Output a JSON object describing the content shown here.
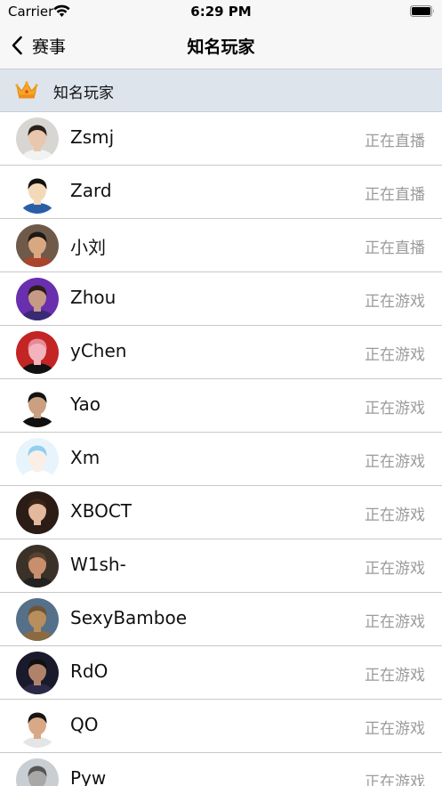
{
  "status_bar": {
    "carrier": "Carrier",
    "time": "6:29 PM"
  },
  "nav": {
    "back_label": "赛事",
    "title": "知名玩家"
  },
  "section": {
    "label": "知名玩家",
    "icon": "crown-icon"
  },
  "players": [
    {
      "name": "Zsmj",
      "status": "正在直播",
      "avatar": "photo-man-light",
      "bg": "#d8d6d2",
      "skin": "#e9c7ad",
      "hair": "#2a211c",
      "shirt": "#f2f2f2"
    },
    {
      "name": "Zard",
      "status": "正在直播",
      "avatar": "cartoon-hooded-character",
      "bg": "#ffffff",
      "skin": "#f3d9b8",
      "hair": "#14110f",
      "shirt": "#2a5fa8"
    },
    {
      "name": "小刘",
      "status": "正在直播",
      "avatar": "photo-man-gaming",
      "bg": "#6f5a4a",
      "skin": "#d9a780",
      "hair": "#1c1916",
      "shirt": "#a9442d"
    },
    {
      "name": "Zhou",
      "status": "正在游戏",
      "avatar": "photo-man-stage",
      "bg": "#6a2fae",
      "skin": "#c69a85",
      "hair": "#2b1e18",
      "shirt": "#3a2a74"
    },
    {
      "name": "yChen",
      "status": "正在游戏",
      "avatar": "cartoon-pig-character",
      "bg": "#c32424",
      "skin": "#f3b3bc",
      "hair": "#e68a98",
      "shirt": "#111111"
    },
    {
      "name": "Yao",
      "status": "正在游戏",
      "avatar": "photo-man-dark-hair",
      "bg": "#ffffff",
      "skin": "#caa080",
      "hair": "#131313",
      "shirt": "#101010"
    },
    {
      "name": "Xm",
      "status": "正在游戏",
      "avatar": "anime-girl-blue-hair",
      "bg": "#e8f4fc",
      "skin": "#fbeee4",
      "hair": "#8fd0f2",
      "shirt": "#ffffff"
    },
    {
      "name": "XBOCT",
      "status": "正在游戏",
      "avatar": "photo-woman-dark-hair",
      "bg": "#2b1c16",
      "skin": "#e4b89c",
      "hair": "#3a2418",
      "shirt": "#2b1c16"
    },
    {
      "name": "W1sh-",
      "status": "正在游戏",
      "avatar": "photo-man-glasses-bald",
      "bg": "#3a3228",
      "skin": "#c98e6e",
      "hair": "#5a4030",
      "shirt": "#222222"
    },
    {
      "name": "SexyBamboe",
      "status": "正在游戏",
      "avatar": "cardboard-robot-figure",
      "bg": "#56708a",
      "skin": "#b88e5c",
      "hair": "#6f5434",
      "shirt": "#8a6a42"
    },
    {
      "name": "RdO",
      "status": "正在游戏",
      "avatar": "photo-man-dark-room",
      "bg": "#1a1a2c",
      "skin": "#b0826a",
      "hair": "#101010",
      "shirt": "#2a2a48"
    },
    {
      "name": "QO",
      "status": "正在游戏",
      "avatar": "photo-man-headshot",
      "bg": "#ffffff",
      "skin": "#d9a886",
      "hair": "#161616",
      "shirt": "#e5e5e5"
    },
    {
      "name": "Pyw",
      "status": "正在游戏",
      "avatar": "photo-man-grey",
      "bg": "#c9ced3",
      "skin": "#a8a8a8",
      "hair": "#555555",
      "shirt": "#777777"
    }
  ]
}
